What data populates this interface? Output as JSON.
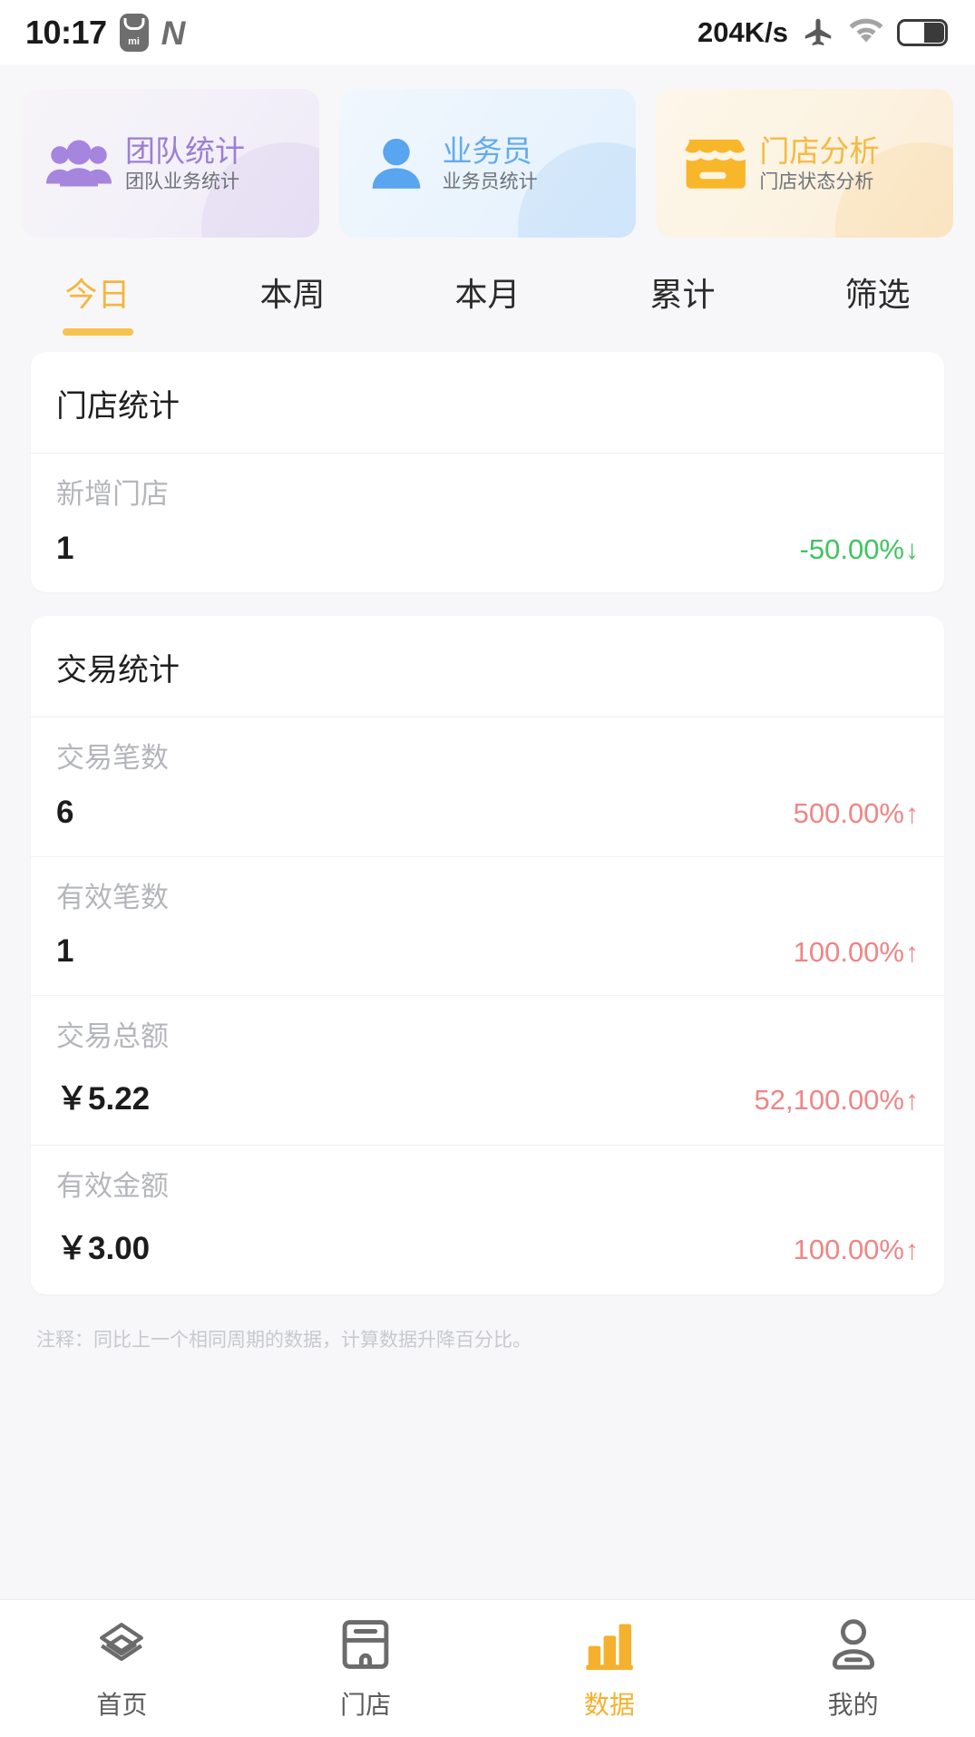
{
  "statusbar": {
    "time": "10:17",
    "mi_label": "mi",
    "n_label": "N",
    "network_speed": "204K/s",
    "airplane_icon": "airplane-icon",
    "wifi_icon": "wifi-icon",
    "battery_icon": "battery-icon"
  },
  "cards": [
    {
      "title": "团队统计",
      "subtitle": "团队业务统计",
      "icon": "group-people-icon",
      "color": "#9b7fd4"
    },
    {
      "title": "业务员",
      "subtitle": "业务员统计",
      "icon": "single-person-icon",
      "color": "#62aaf0"
    },
    {
      "title": "门店分析",
      "subtitle": "门店状态分析",
      "icon": "storefront-icon",
      "color": "#f5b942"
    }
  ],
  "tabs": [
    {
      "label": "今日",
      "active": true
    },
    {
      "label": "本周",
      "active": false
    },
    {
      "label": "本月",
      "active": false
    },
    {
      "label": "累计",
      "active": false
    },
    {
      "label": "筛选",
      "active": false
    }
  ],
  "panels": [
    {
      "title": "门店统计",
      "rows": [
        {
          "label": "新增门店",
          "value": "1",
          "delta": "-50.00%",
          "arrow": "↓",
          "direction": "down"
        }
      ]
    },
    {
      "title": "交易统计",
      "rows": [
        {
          "label": "交易笔数",
          "value": "6",
          "delta": "500.00%",
          "arrow": "↑",
          "direction": "up"
        },
        {
          "label": "有效笔数",
          "value": "1",
          "delta": "100.00%",
          "arrow": "↑",
          "direction": "up"
        },
        {
          "label": "交易总额",
          "value": "￥5.22",
          "delta": "52,100.00%",
          "arrow": "↑",
          "direction": "up"
        },
        {
          "label": "有效金额",
          "value": "￥3.00",
          "delta": "100.00%",
          "arrow": "↑",
          "direction": "up"
        }
      ]
    }
  ],
  "footnote": "注释：同比上一个相同周期的数据，计算数据升降百分比。",
  "bottom_nav": [
    {
      "label": "首页",
      "icon": "cards-stack-icon",
      "active": false
    },
    {
      "label": "门店",
      "icon": "store-icon",
      "active": false
    },
    {
      "label": "数据",
      "icon": "bar-chart-icon",
      "active": true
    },
    {
      "label": "我的",
      "icon": "person-icon",
      "active": false
    }
  ],
  "colors": {
    "accent": "#f5b02e",
    "tab_active": "#f3b63f",
    "delta_up": "#ef8585",
    "delta_down": "#3fc45f",
    "page_bg": "#f7f7f9"
  }
}
